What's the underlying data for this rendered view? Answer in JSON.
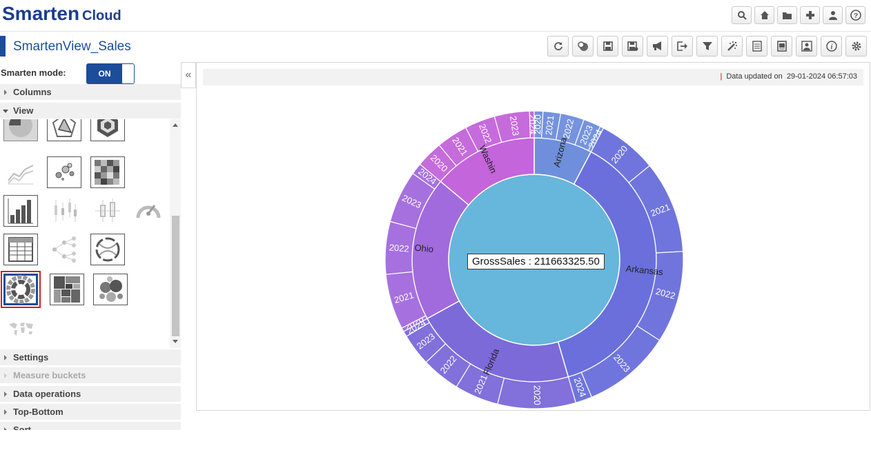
{
  "header": {
    "logo_main": "Smarten",
    "logo_sub": "Cloud",
    "icons": [
      "search-icon",
      "home-icon",
      "folder-icon",
      "plus-icon",
      "user-icon",
      "help-icon"
    ]
  },
  "view": {
    "title": "SmartenView_Sales",
    "toolbar_icons": [
      "refresh-icon",
      "globe-icon",
      "save-icon",
      "save-as-icon",
      "announce-icon",
      "export-icon",
      "filter-icon",
      "magic-icon",
      "report-icon",
      "print-icon",
      "image-icon",
      "info-icon",
      "settings-icon"
    ]
  },
  "left_panel": {
    "mode_label": "Smarten mode:",
    "mode_toggle": "ON",
    "sections": {
      "columns": "Columns",
      "view": "View",
      "settings": "Settings",
      "measure_buckets": "Measure buckets",
      "data_operations": "Data operations",
      "top_bottom": "Top-Bottom",
      "sort": "Sort"
    },
    "selected_chart": "sunburst-chart"
  },
  "chart_panel": {
    "updated_label": "Data updated on",
    "updated_value": "29-01-2024 06:57:03",
    "tooltip": "GrossSales : 211663325.50"
  },
  "chart_data": {
    "type": "sunburst",
    "measure": "GrossSales",
    "total": 211663325.5,
    "center_color": "#67b6db",
    "states": [
      {
        "name": "Arizona",
        "share": 0.077,
        "color": "#6f8fdd",
        "years": [
          {
            "year": "2020",
            "share": 0.01
          },
          {
            "year": "2021",
            "share": 0.02
          },
          {
            "year": "2022",
            "share": 0.027
          },
          {
            "year": "2023",
            "share": 0.02
          },
          {
            "year": "2024",
            "share": 0.004
          }
        ]
      },
      {
        "name": "Arkansas",
        "share": 0.378,
        "color": "#6a6fdc",
        "years": [
          {
            "year": "2020",
            "share": 0.064
          },
          {
            "year": "2021",
            "share": 0.1
          },
          {
            "year": "2022",
            "share": 0.1
          },
          {
            "year": "2023",
            "share": 0.096
          },
          {
            "year": "2024",
            "share": 0.018
          }
        ]
      },
      {
        "name": "Florida",
        "share": 0.215,
        "color": "#7d6ad9",
        "years": [
          {
            "year": "2020",
            "share": 0.085
          },
          {
            "year": "2021",
            "share": 0.048
          },
          {
            "year": "2022",
            "share": 0.042
          },
          {
            "year": "2023",
            "share": 0.035
          },
          {
            "year": "2024",
            "share": 0.006
          }
        ]
      },
      {
        "name": "Ohio",
        "share": 0.191,
        "color": "#a26bdd",
        "years": [
          {
            "year": "2020",
            "share": 0.004
          },
          {
            "year": "2021",
            "share": 0.058
          },
          {
            "year": "2022",
            "share": 0.055
          },
          {
            "year": "2023",
            "share": 0.055
          },
          {
            "year": "2024",
            "share": 0.012
          }
        ]
      },
      {
        "name": "Washin",
        "share": 0.139,
        "color": "#c465db",
        "years": [
          {
            "year": "2020",
            "share": 0.029
          },
          {
            "year": "2021",
            "share": 0.034
          },
          {
            "year": "2022",
            "share": 0.033
          },
          {
            "year": "2023",
            "share": 0.038
          },
          {
            "year": "2024",
            "share": 0.005
          }
        ]
      }
    ]
  }
}
